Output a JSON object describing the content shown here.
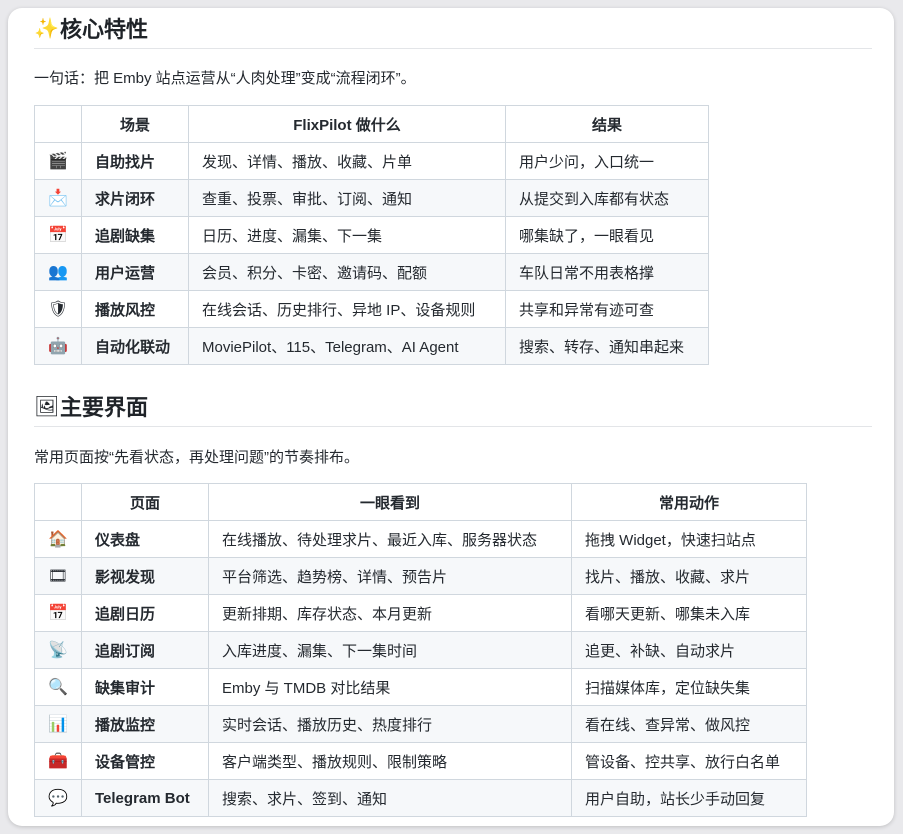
{
  "section1": {
    "emoji": "✨",
    "title": "核心特性",
    "intro": "一句话：把 Emby 站点运营从“人肉处理”变成“流程闭环”。",
    "headers": [
      "",
      "场景",
      "FlixPilot 做什么",
      "结果"
    ],
    "rows": [
      {
        "icon_name": "clapper-board-icon",
        "icon": "🎬",
        "scene": "自助找片",
        "what": "发现、详情、播放、收藏、片单",
        "result": "用户少问，入口统一"
      },
      {
        "icon_name": "inbox-tray-icon",
        "icon": "📩",
        "scene": "求片闭环",
        "what": "查重、投票、审批、订阅、通知",
        "result": "从提交到入库都有状态"
      },
      {
        "icon_name": "calendar-icon",
        "icon": "📅",
        "scene": "追剧缺集",
        "what": "日历、进度、漏集、下一集",
        "result": "哪集缺了，一眼看见"
      },
      {
        "icon_name": "users-icon",
        "icon": "👥",
        "scene": "用户运营",
        "what": "会员、积分、卡密、邀请码、配额",
        "result": "车队日常不用表格撑"
      },
      {
        "icon_name": "shield-icon",
        "icon": "🛡",
        "scene": "播放风控",
        "what": "在线会话、历史排行、异地 IP、设备规则",
        "result": "共享和异常有迹可查"
      },
      {
        "icon_name": "robot-icon",
        "icon": "🤖",
        "scene": "自动化联动",
        "what": "MoviePilot、115、Telegram、AI Agent",
        "result": "搜索、转存、通知串起来"
      }
    ]
  },
  "section2": {
    "emoji": "🖼",
    "title": "主要界面",
    "intro": "常用页面按“先看状态，再处理问题”的节奏排布。",
    "headers": [
      "",
      "页面",
      "一眼看到",
      "常用动作"
    ],
    "rows": [
      {
        "icon_name": "house-icon",
        "icon": "🏠",
        "page": "仪表盘",
        "see": "在线播放、待处理求片、最近入库、服务器状态",
        "action": "拖拽 Widget，快速扫站点"
      },
      {
        "icon_name": "film-box-icon",
        "icon": "🎞",
        "page": "影视发现",
        "see": "平台筛选、趋势榜、详情、预告片",
        "action": "找片、播放、收藏、求片"
      },
      {
        "icon_name": "calendar-icon",
        "icon": "📅",
        "page": "追剧日历",
        "see": "更新排期、库存状态、本月更新",
        "action": "看哪天更新、哪集未入库"
      },
      {
        "icon_name": "satellite-dish-icon",
        "icon": "📡",
        "page": "追剧订阅",
        "see": "入库进度、漏集、下一集时间",
        "action": "追更、补缺、自动求片"
      },
      {
        "icon_name": "magnifier-icon",
        "icon": "🔍",
        "page": "缺集审计",
        "see": "Emby 与 TMDB 对比结果",
        "action": "扫描媒体库，定位缺失集"
      },
      {
        "icon_name": "bar-chart-icon",
        "icon": "📊",
        "page": "播放监控",
        "see": "实时会话、播放历史、热度排行",
        "action": "看在线、查异常、做风控"
      },
      {
        "icon_name": "toolbox-icon",
        "icon": "🧰",
        "page": "设备管控",
        "see": "客户端类型、播放规则、限制策略",
        "action": "管设备、控共享、放行白名单"
      },
      {
        "icon_name": "speech-bubble-icon",
        "icon": "💬",
        "page": "Telegram Bot",
        "see": "搜索、求片、签到、通知",
        "action": "用户自助，站长少手动回复"
      }
    ]
  }
}
